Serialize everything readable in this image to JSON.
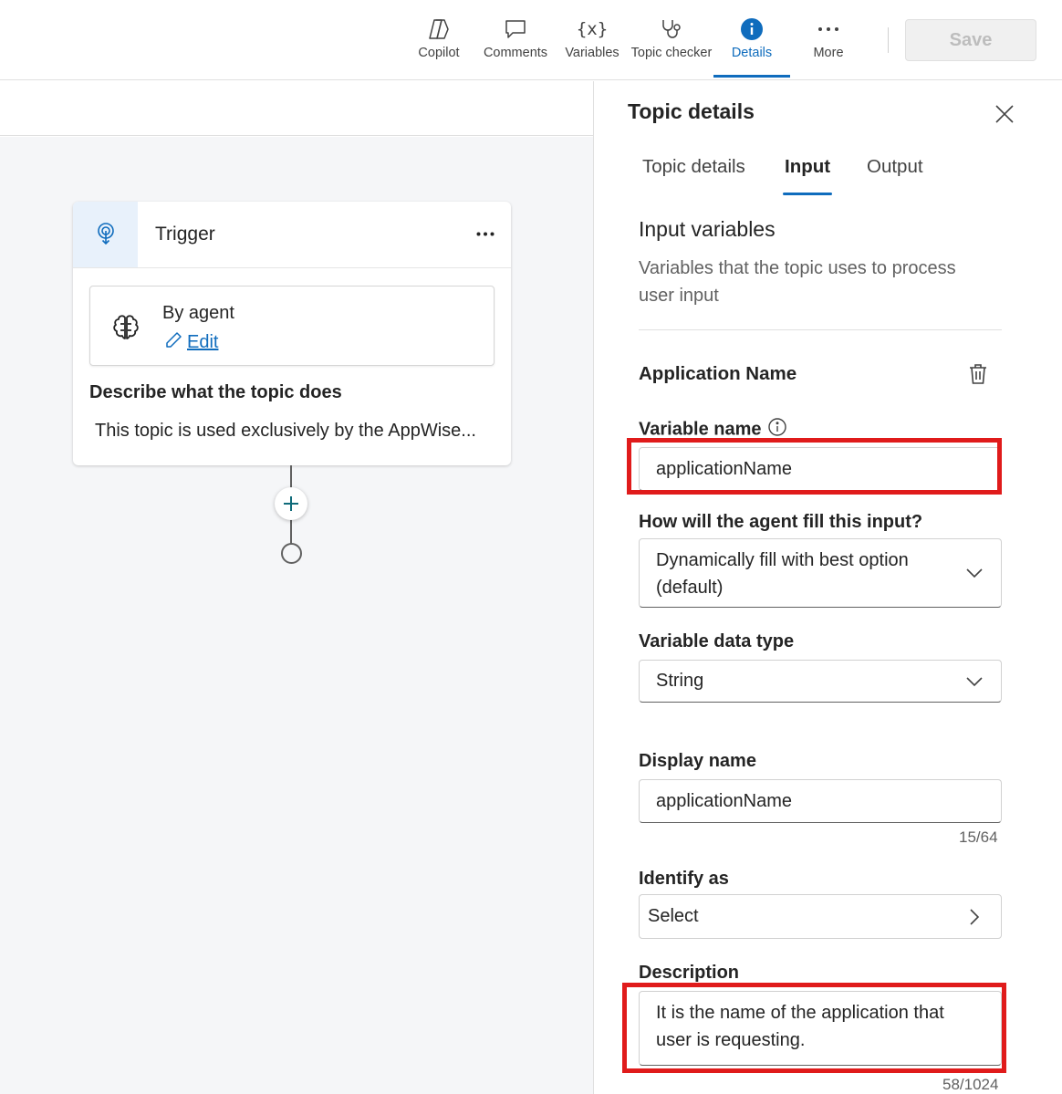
{
  "toolbar": {
    "items": [
      {
        "label": "Copilot",
        "icon": "copilot-icon"
      },
      {
        "label": "Comments",
        "icon": "comment-icon"
      },
      {
        "label": "Variables",
        "icon": "variables-icon"
      },
      {
        "label": "Topic checker",
        "icon": "stethoscope-icon"
      },
      {
        "label": "Details",
        "icon": "info-icon",
        "active": true
      },
      {
        "label": "More",
        "icon": "more-icon"
      }
    ],
    "save_label": "Save",
    "accent": "#0f6cbd"
  },
  "canvas": {
    "trigger": {
      "title": "Trigger",
      "agent_title": "By agent",
      "edit_label": "Edit",
      "describe_label": "Describe what the topic does",
      "describe_text": "This topic is used exclusively by the AppWise..."
    }
  },
  "panel": {
    "title": "Topic details",
    "tabs": [
      {
        "label": "Topic details"
      },
      {
        "label": "Input",
        "active": true
      },
      {
        "label": "Output"
      }
    ],
    "section_title": "Input variables",
    "section_desc": "Variables that the topic uses to process user input",
    "variable": {
      "heading": "Application Name",
      "variable_name_label": "Variable name",
      "variable_name_value": "applicationName",
      "fill_label": "How will the agent fill this input?",
      "fill_value": "Dynamically fill with best option (default)",
      "data_type_label": "Variable data type",
      "data_type_value": "String",
      "display_name_label": "Display name",
      "display_name_value": "applicationName",
      "display_name_counter": "15/64",
      "identify_label": "Identify as",
      "identify_value": "Select",
      "description_label": "Description",
      "description_value": "It is the name of the application that user is requesting.",
      "description_counter": "58/1024"
    },
    "highlight_color": "#e01b1b"
  }
}
